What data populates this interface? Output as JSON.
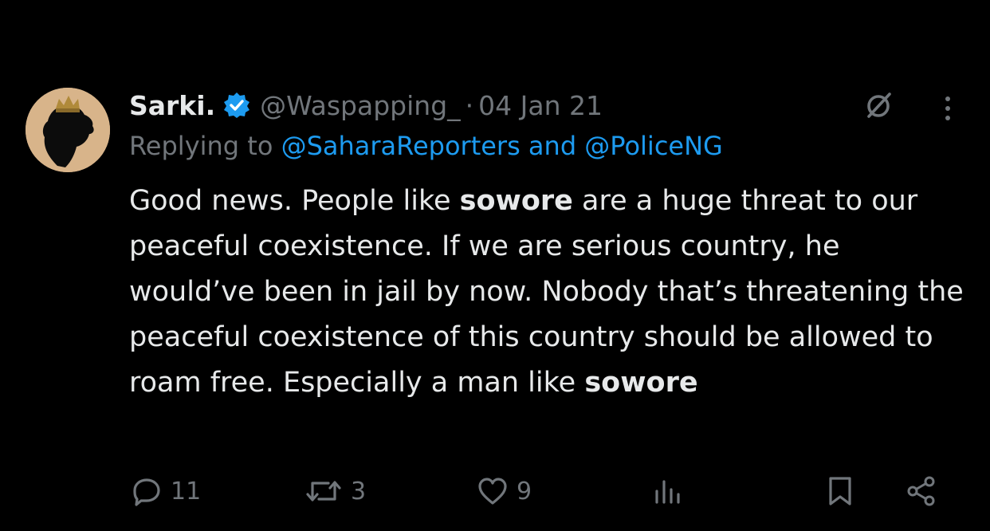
{
  "tweet": {
    "author_name": "Sarki.",
    "handle": "@Waspapping_",
    "separator": "·",
    "date": "04 Jan 21",
    "replying_prefix": "Replying to",
    "mention_1": "@SaharaReporters",
    "and_word": "and",
    "mention_2": "@PoliceNG",
    "body": {
      "part1": "Good news. People like ",
      "bold1": "sowore",
      "part2": " are a huge threat to our peaceful coexistence. If we are serious country, he would’ve been in jail by now. Nobody that’s threatening the peaceful coexistence of this country should be allowed to roam free. Especially a man like ",
      "bold2": "sowore"
    }
  },
  "actions": {
    "reply_count": "11",
    "retweet_count": "3",
    "like_count": "9",
    "views_icon": "bar-chart-icon",
    "bookmark_icon": "bookmark-icon",
    "share_icon": "share-icon"
  },
  "icons": {
    "verified": "verified-badge-icon",
    "grok": "grok-icon",
    "more": "more-vertical-icon"
  },
  "colors": {
    "background": "#000000",
    "text": "#e7e9ea",
    "muted": "#71767b",
    "accent": "#1d9bf0",
    "avatar_bg": "#d8b48a"
  }
}
